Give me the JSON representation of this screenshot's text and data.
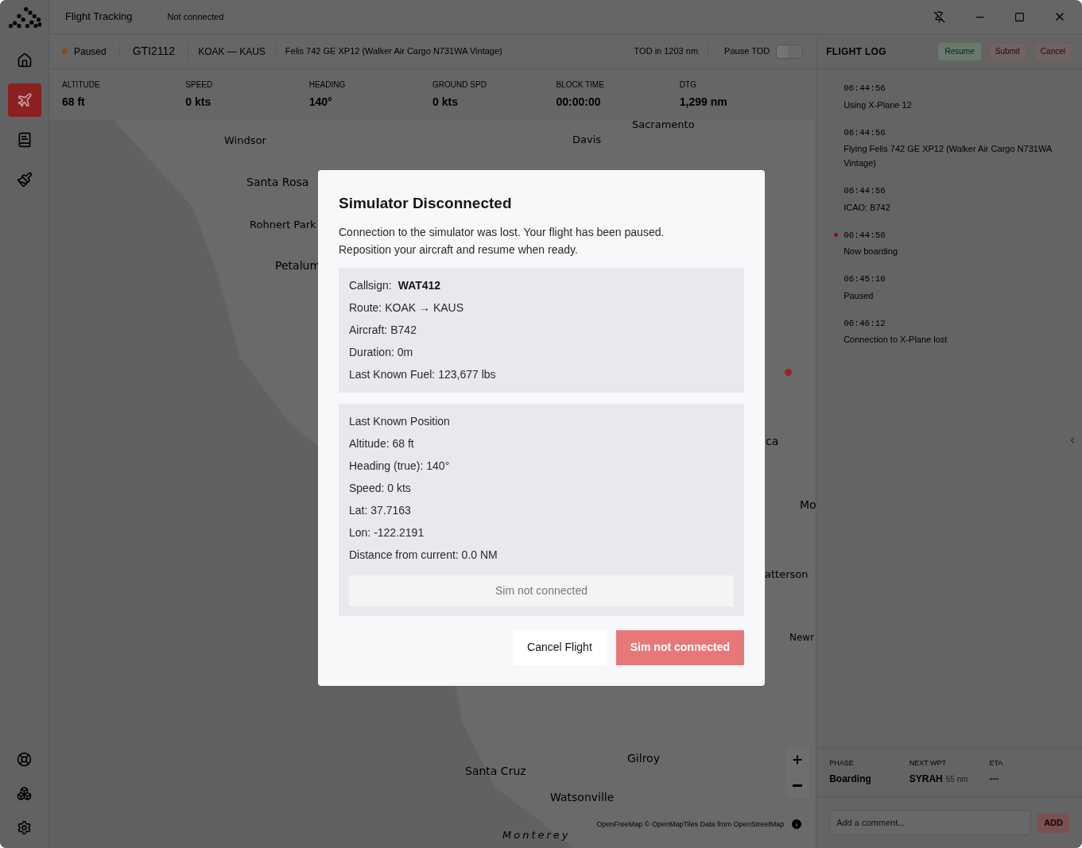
{
  "titlebar": {
    "title": "Flight Tracking",
    "connection": "Not connected"
  },
  "sidebar": {
    "items": [
      {
        "selected": false
      },
      {
        "selected": true
      },
      {
        "selected": false
      },
      {
        "selected": false
      }
    ]
  },
  "flight_bar": {
    "status": "Paused",
    "callsign": "GTI2112",
    "route": "KOAK — KAUS",
    "aircraft": "Felis 742 GE XP12 (Walker Air Cargo N731WA Vintage)",
    "tod": "TOD in 1203 nm",
    "pause_tod": {
      "label": "Pause TOD",
      "on": false
    }
  },
  "stats": [
    {
      "label": "ALTITUDE",
      "value": "68 ft"
    },
    {
      "label": "SPEED",
      "value": "0 kts"
    },
    {
      "label": "HEADING",
      "value": "140°"
    },
    {
      "label": "GROUND SPD",
      "value": "0 kts"
    },
    {
      "label": "BLOCK TIME",
      "value": "00:00:00"
    },
    {
      "label": "DTG",
      "value": "1,299 nm"
    }
  ],
  "map": {
    "labels": [
      "Sacramento",
      "Windsor",
      "Davis",
      "Santa Rosa",
      "Rohnert Park",
      "Petalum",
      "ca",
      "Mo",
      "atterson",
      "Newr",
      "Gilroy",
      "Santa Cruz",
      "Watsonville",
      "Monterey"
    ],
    "attribution": "OpenFreeMap © OpenMapTiles Data from OpenStreetMap"
  },
  "flight_log": {
    "title": "FLIGHT LOG",
    "buttons": [
      {
        "label": "Resume",
        "kind": "resume"
      },
      {
        "label": "Submit",
        "kind": "danger"
      },
      {
        "label": "Cancel",
        "kind": "danger"
      }
    ],
    "entries": [
      {
        "time": "06:44:56",
        "text": "Using X-Plane 12",
        "marked": false
      },
      {
        "time": "06:44:56",
        "text": "Flying Felis 742 GE XP12 (Walker Air Cargo N731WA Vintage)",
        "marked": false
      },
      {
        "time": "06:44:56",
        "text": "ICAO: B742",
        "marked": false
      },
      {
        "time": "06:44:56",
        "text": "Now boarding",
        "marked": true
      },
      {
        "time": "06:45:10",
        "text": "Paused",
        "marked": false
      },
      {
        "time": "06:46:12",
        "text": "Connection to X-Plane lost",
        "marked": false
      }
    ]
  },
  "progress": {
    "phase_label": "PHASE",
    "phase": "Boarding",
    "next_label": "NEXT WPT",
    "next": "SYRAH",
    "next_dist": "55 nm",
    "eta_label": "ETA",
    "eta": "---"
  },
  "comment": {
    "placeholder": "Add a comment...",
    "button": "ADD"
  },
  "modal": {
    "title": "Simulator Disconnected",
    "message": "Connection to the simulator was lost. Your flight has been paused. Reposition your aircraft and resume when ready.",
    "summary": [
      {
        "label": "Callsign:",
        "value": "WAT412"
      },
      {
        "label": "Route:",
        "value": "KOAK → KAUS"
      },
      {
        "label": "Aircraft:",
        "value": "B742"
      },
      {
        "label": "Duration:",
        "value": "0m"
      },
      {
        "label": "Last Known Fuel:",
        "value": "123,677 lbs"
      }
    ],
    "position_title": "Last Known Position",
    "position": [
      "Altitude: 68 ft",
      "Heading (true): 140°",
      "Speed: 0 kts",
      "Lat: 37.7163",
      "Lon: -122.2191",
      "Distance from current: 0.0 NM"
    ],
    "inner_button": {
      "label": "Sim not connected",
      "disabled": true
    },
    "cancel": "Cancel Flight",
    "primary": {
      "label": "Sim not connected",
      "disabled": true
    }
  }
}
